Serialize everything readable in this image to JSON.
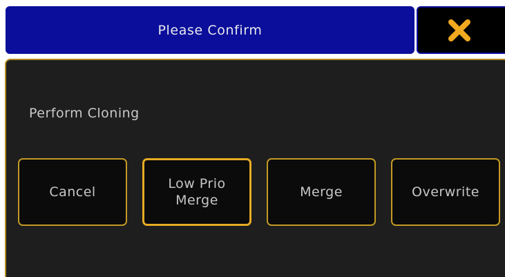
{
  "dialog": {
    "title": "Please Confirm",
    "close_icon": "close-x-icon",
    "message": "Perform Cloning"
  },
  "buttons": {
    "cancel": "Cancel",
    "low_prio_merge": "Low Prio\nMerge",
    "merge": "Merge",
    "overwrite": "Overwrite"
  },
  "colors": {
    "title_bar": "#0a0e9a",
    "accent_border": "#c49a25",
    "close_icon": "#f2a91f",
    "dialog_background": "#1e1e1e"
  }
}
